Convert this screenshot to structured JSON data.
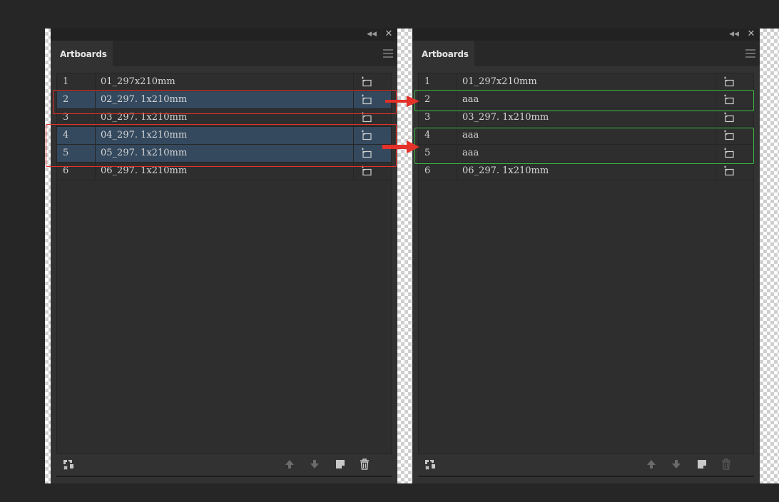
{
  "panels": [
    {
      "id": "before",
      "tab_label": "Artboards",
      "rows": [
        {
          "num": "1",
          "name": "01_297x210mm",
          "selected": false
        },
        {
          "num": "2",
          "name": "02_297. 1x210mm",
          "selected": true
        },
        {
          "num": "3",
          "name": "03_297. 1x210mm",
          "selected": false
        },
        {
          "num": "4",
          "name": "04_297. 1x210mm",
          "selected": true
        },
        {
          "num": "5",
          "name": "05_297. 1x210mm",
          "selected": true
        },
        {
          "num": "6",
          "name": "06_297. 1x210mm",
          "selected": false
        }
      ]
    },
    {
      "id": "after",
      "tab_label": "Artboards",
      "rows": [
        {
          "num": "1",
          "name": "01_297x210mm",
          "selected": false
        },
        {
          "num": "2",
          "name": "aaa",
          "selected": false
        },
        {
          "num": "3",
          "name": "03_297. 1x210mm",
          "selected": false
        },
        {
          "num": "4",
          "name": "aaa",
          "selected": false
        },
        {
          "num": "5",
          "name": "aaa",
          "selected": false
        },
        {
          "num": "6",
          "name": "06_297. 1x210mm",
          "selected": false
        }
      ]
    }
  ],
  "icons": {
    "title_collapse": "double-chevron-left-icon",
    "title_close": "close-icon",
    "menu": "panel-menu-icon",
    "row": "artboard-options-icon",
    "footer": [
      "rearrange-artboards-icon",
      "move-up-icon",
      "move-down-icon",
      "new-artboard-icon",
      "delete-artboard-icon"
    ]
  },
  "colors": {
    "selection": "#34495e",
    "highlight_before": "#e4312a",
    "highlight_after": "#3bb83f",
    "arrow": "#e4312a"
  }
}
